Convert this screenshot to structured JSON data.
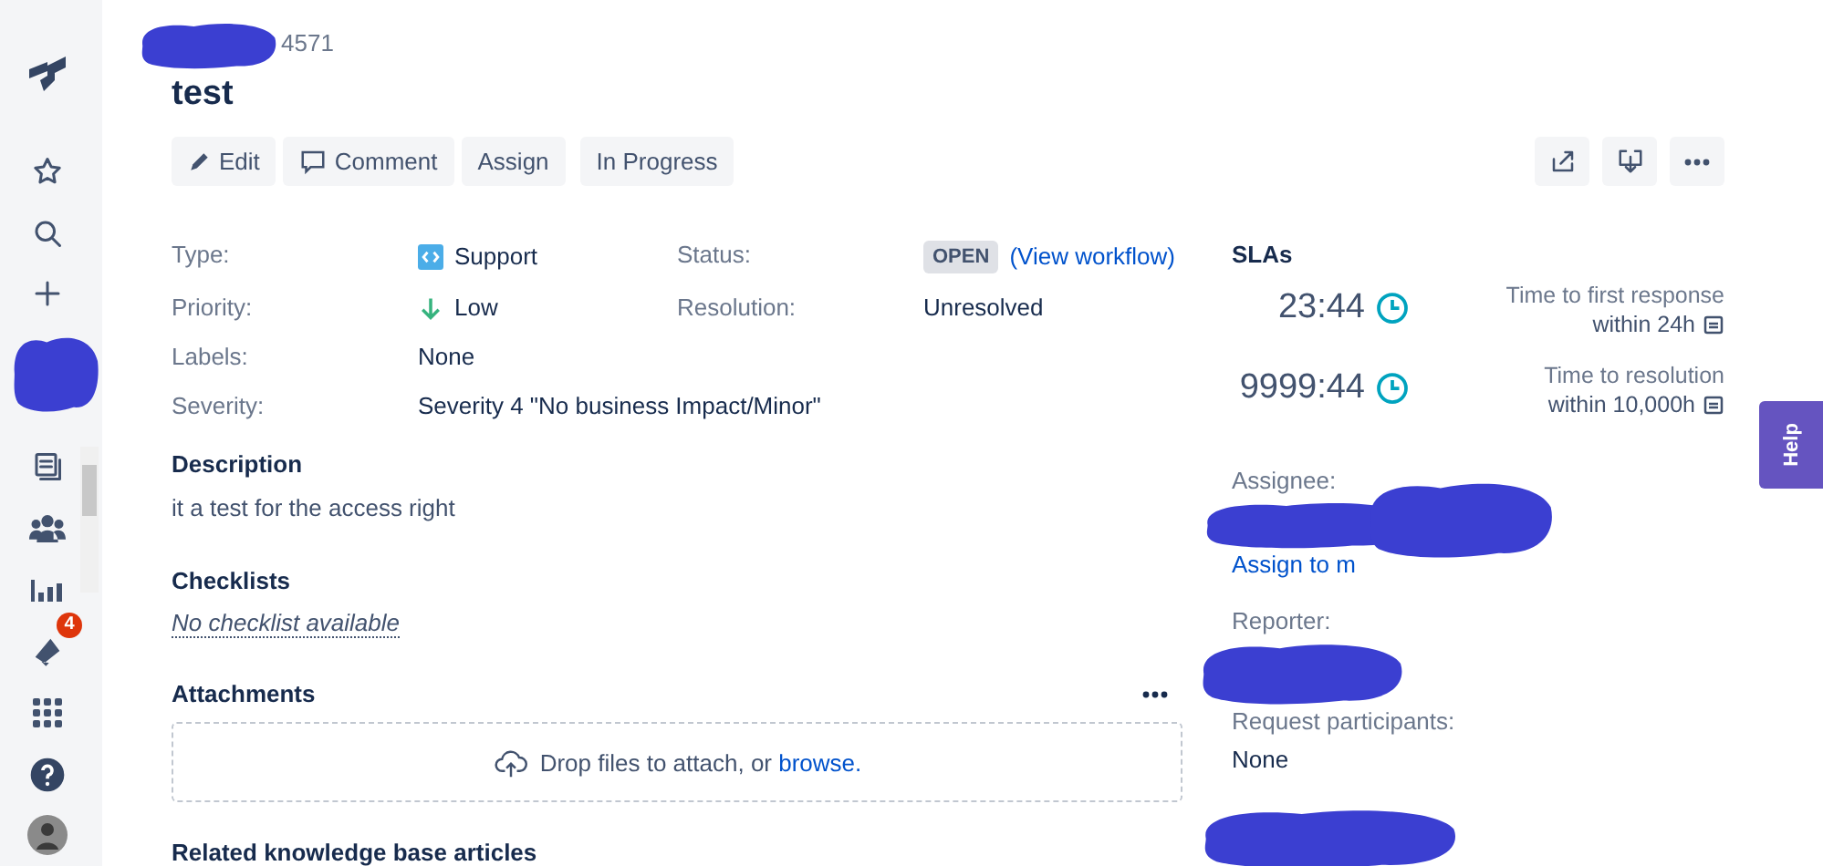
{
  "issue": {
    "key": "4571",
    "title": "test"
  },
  "sidebar": {
    "notification_count": "4"
  },
  "actions": [
    {
      "kind": "edit",
      "label": "Edit"
    },
    {
      "kind": "comment",
      "label": "Comment"
    },
    {
      "kind": "plain",
      "label": "Assign"
    },
    {
      "kind": "plain",
      "label": "In Progress"
    }
  ],
  "details": [
    {
      "label": "Type:",
      "kind": "type",
      "value": "Support"
    },
    {
      "label": "Priority:",
      "kind": "priority",
      "value": "Low"
    },
    {
      "label": "Labels:",
      "kind": "text",
      "value": "None"
    },
    {
      "label": "Severity:",
      "kind": "text",
      "value": "Severity 4 \"No business Impact/Minor\""
    }
  ],
  "details_right": [
    {
      "label": "Status:",
      "kind": "status",
      "lozenge": "OPEN",
      "link": "(View workflow)"
    },
    {
      "label": "Resolution:",
      "kind": "text",
      "value": "Unresolved"
    }
  ],
  "description": {
    "heading": "Description",
    "text": "it a test for the access right"
  },
  "checklists": {
    "heading": "Checklists",
    "empty": "No checklist available"
  },
  "attachments": {
    "heading": "Attachments",
    "drop_text": "Drop files to attach, or",
    "browse_link": "browse."
  },
  "related": {
    "heading": "Related knowledge base articles"
  },
  "slas": {
    "heading": "SLAs",
    "items": [
      {
        "time": "23:44",
        "name": "Time to first response",
        "goal": "within 24h"
      },
      {
        "time": "9999:44",
        "name": "Time to resolution",
        "goal": "within 10,000h"
      }
    ]
  },
  "people": [
    {
      "label": "Assignee:",
      "link": "Assign to m"
    },
    {
      "label": "Reporter:"
    },
    {
      "label": "Request participants:",
      "value": "None"
    }
  ],
  "help_tab": "Help"
}
